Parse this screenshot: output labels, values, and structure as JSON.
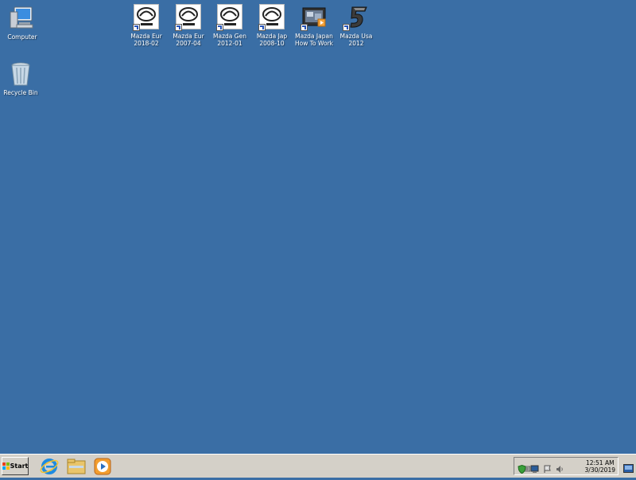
{
  "desktop": {
    "icons": [
      {
        "label": "Computer"
      },
      {
        "label": "Recycle Bin"
      },
      {
        "label": "Mazda Eur\n2018-02"
      },
      {
        "label": "Mazda Eur\n2007-04"
      },
      {
        "label": "Mazda Gen\n2012-01"
      },
      {
        "label": "Mazda Jap\n2008-10"
      },
      {
        "label": "Mazda Japan\nHow To Work"
      },
      {
        "label": "Mazda Usa\n2012"
      }
    ]
  },
  "taskbar": {
    "start_label": "Start",
    "quick_launch": [
      "internet-explorer-icon",
      "file-explorer-icon",
      "media-player-icon"
    ],
    "clock": {
      "time": "12:51 AM",
      "date": "3/30/2019"
    }
  },
  "colors": {
    "desktop": "#3a6ea5",
    "taskbar": "#d4d0c8"
  }
}
